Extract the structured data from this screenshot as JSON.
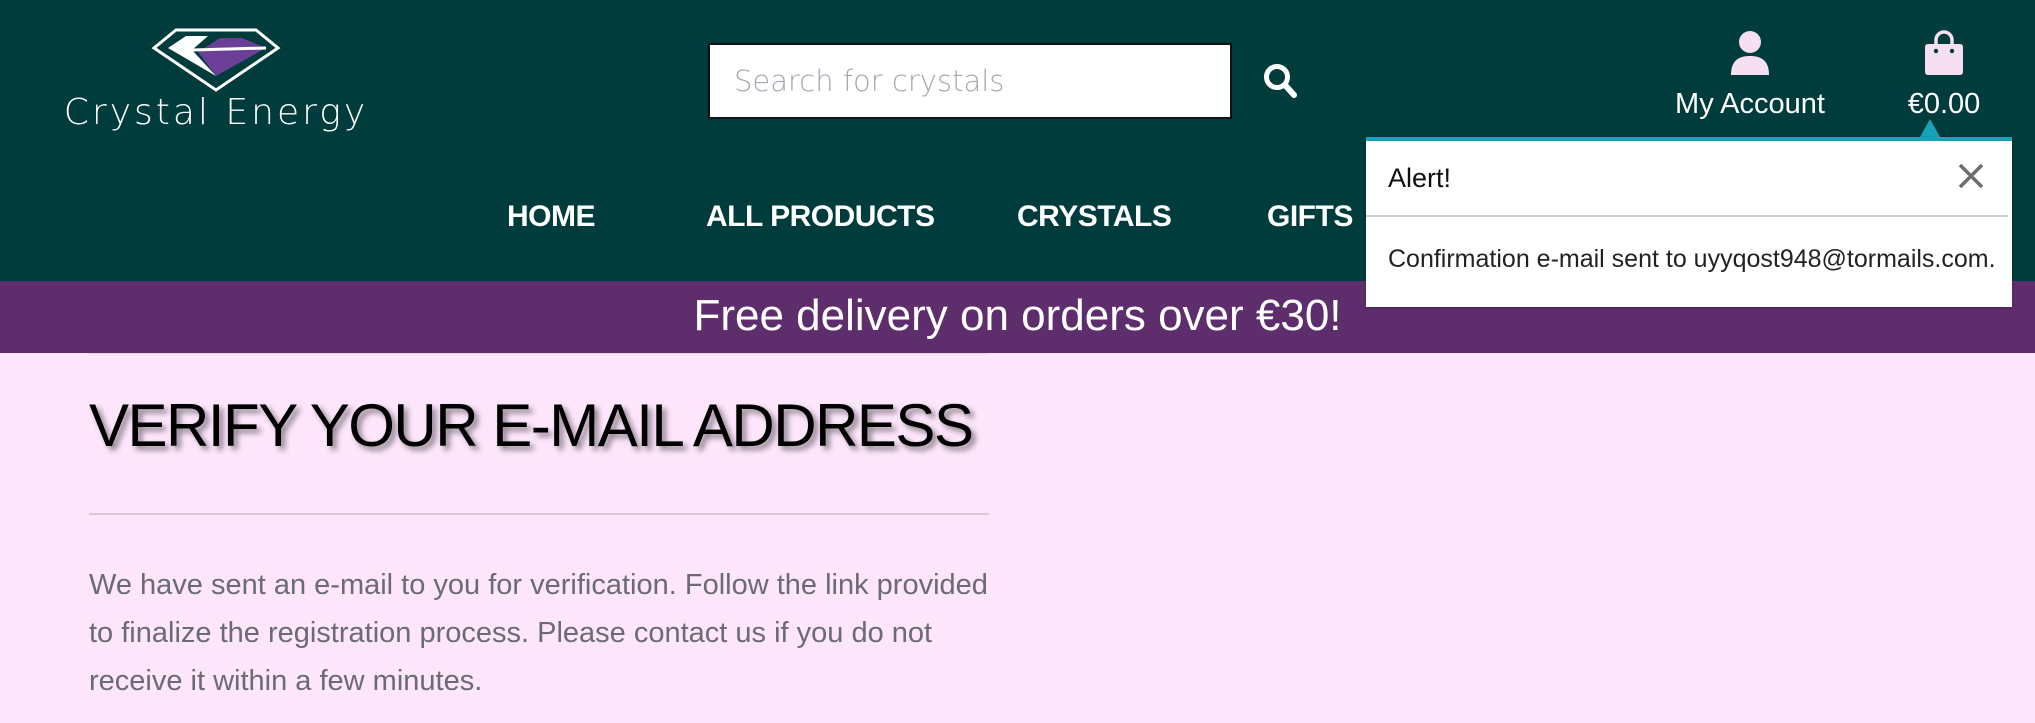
{
  "brand": {
    "name": "Crystal Energy"
  },
  "search": {
    "placeholder": "Search for crystals",
    "value": ""
  },
  "account": {
    "label": "My Account"
  },
  "cart": {
    "total": "€0.00"
  },
  "nav": {
    "items": [
      {
        "label": "HOME"
      },
      {
        "label": "ALL PRODUCTS"
      },
      {
        "label": "CRYSTALS"
      },
      {
        "label": "GIFTS"
      }
    ]
  },
  "banner": {
    "text": "Free delivery on orders over €30!"
  },
  "main": {
    "title": "VERIFY YOUR E-MAIL ADDRESS",
    "message": "We have sent an e-mail to you for verification. Follow the link provided to finalize the registration process. Please contact us if you do not receive it within a few minutes."
  },
  "alert": {
    "title": "Alert!",
    "message": "Confirmation e-mail sent to uyyqost948@tormails.com."
  },
  "colors": {
    "header_bg": "#003c3c",
    "banner_bg": "#5e2e6c",
    "page_bg": "#fde6fb",
    "alert_accent": "#17a2b8",
    "logo_accent": "#6b3f98",
    "icon_pink": "#f6dff3"
  },
  "icons": {
    "search": "magnifier-icon",
    "account": "user-icon",
    "cart": "shopping-bag-icon",
    "close": "close-icon",
    "logo": "crystal-logo-icon"
  }
}
